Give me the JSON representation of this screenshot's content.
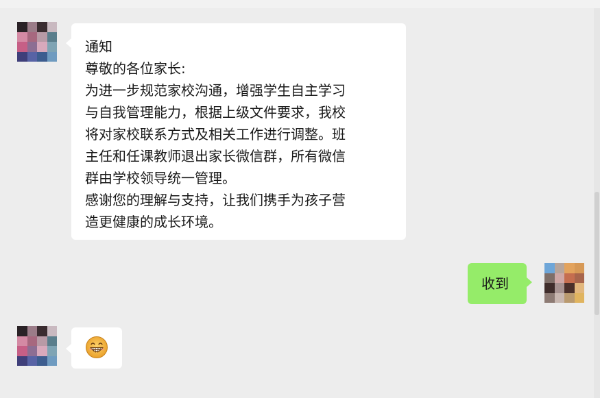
{
  "messages": [
    {
      "side": "left",
      "type": "text",
      "lines": [
        "通知",
        "尊敬的各位家长:",
        "为进一步规范家校沟通，增强学生自主学习",
        "与自我管理能力，根据上级文件要求，我校",
        "将对家校联系方式及相关工作进行调整。班",
        "主任和任课教师退出家长微信群，所有微信",
        "群由学校领导统一管理。",
        "感谢您的理解与支持，让我们携手为孩子营",
        "造更健康的成长环境。"
      ]
    },
    {
      "side": "right",
      "type": "text",
      "text": "收到"
    },
    {
      "side": "left",
      "type": "emoji",
      "emoji_name": "grinning-face-emoji"
    }
  ],
  "colors": {
    "chat_background": "#ededed",
    "left_bubble": "#ffffff",
    "right_bubble": "#95ec69",
    "text": "#191919"
  }
}
